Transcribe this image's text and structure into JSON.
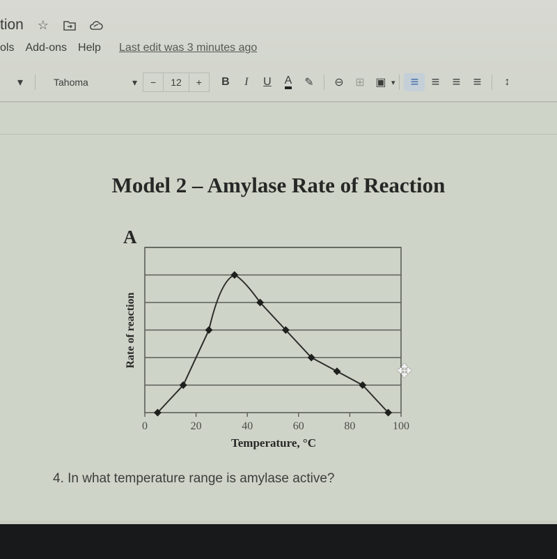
{
  "window": {
    "doc_title_partial": "tion",
    "star_icon": "star-icon",
    "move_icon": "move-to-folder-icon",
    "cloud_icon": "cloud-saved-icon"
  },
  "menu": {
    "items": [
      "ols",
      "Add-ons",
      "Help"
    ],
    "last_edit": "Last edit was 3 minutes ago"
  },
  "toolbar": {
    "style_dropdown_arrow": "▾",
    "font": "Tahoma",
    "font_arrow": "▾",
    "size_minus": "−",
    "font_size": "12",
    "size_plus": "+",
    "bold": "B",
    "italic": "I",
    "underline": "U",
    "text_color": "A",
    "highlight": "✎",
    "link": "⊖",
    "comment": "⊞",
    "image": "▣",
    "image_arrow": "▾",
    "align_left": "≡",
    "align_center": "≡",
    "align_right": "≡",
    "justify": "≡",
    "line_spacing": "↕"
  },
  "document": {
    "model_title": "Model 2 – Amylase Rate of Reaction",
    "question": "4. In what temperature range is amylase active?"
  },
  "chart_data": {
    "type": "line",
    "panel_label": "A",
    "title": "Model 2 – Amylase Rate of Reaction",
    "xlabel": "Temperature, °C",
    "ylabel": "Rate of reaction",
    "xlim": [
      0,
      100
    ],
    "ylim": [
      0,
      6
    ],
    "xticks": [
      0,
      20,
      40,
      60,
      80,
      100
    ],
    "xtick_labels": [
      "0",
      "20",
      "40",
      "60",
      "80",
      "100"
    ],
    "y_gridlines": [
      1,
      2,
      3,
      4,
      5,
      6
    ],
    "grid": true,
    "marker": "diamond",
    "smooth_peak": true,
    "series": [
      {
        "name": "Amylase",
        "x": [
          5,
          15,
          25,
          35,
          45,
          55,
          65,
          75,
          85,
          95
        ],
        "y": [
          0,
          1,
          3,
          5,
          4,
          3,
          2,
          1.5,
          1,
          0
        ]
      }
    ],
    "colors": {
      "line": "#2a2c2a",
      "grid": "#5a5e58",
      "background": "#cfd4c8"
    }
  }
}
